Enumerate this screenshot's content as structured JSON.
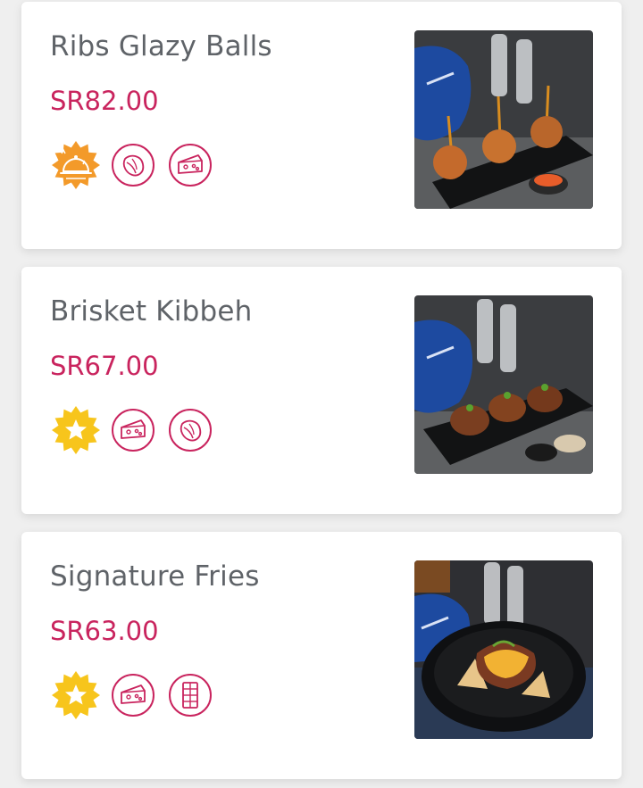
{
  "items": [
    {
      "name": "Ribs Glazy Balls",
      "price": "SR82.00",
      "badges": [
        "chef-special-icon",
        "nut-icon",
        "cheese-icon"
      ],
      "photo": "meatballs-on-skewers-photo"
    },
    {
      "name": "Brisket Kibbeh",
      "price": "SR67.00",
      "badges": [
        "star-icon",
        "cheese-icon",
        "nut-icon"
      ],
      "photo": "kibbeh-plate-photo"
    },
    {
      "name": "Signature Fries",
      "price": "SR63.00",
      "badges": [
        "star-icon",
        "cheese-icon",
        "chocolate-icon"
      ],
      "photo": "loaded-fries-bowl-photo"
    }
  ],
  "colors": {
    "title": "#5f6368",
    "price": "#c9245e",
    "badge_outline": "#c9245e",
    "chef_badge": "#f39a2a",
    "star_badge": "#f7c51c"
  }
}
